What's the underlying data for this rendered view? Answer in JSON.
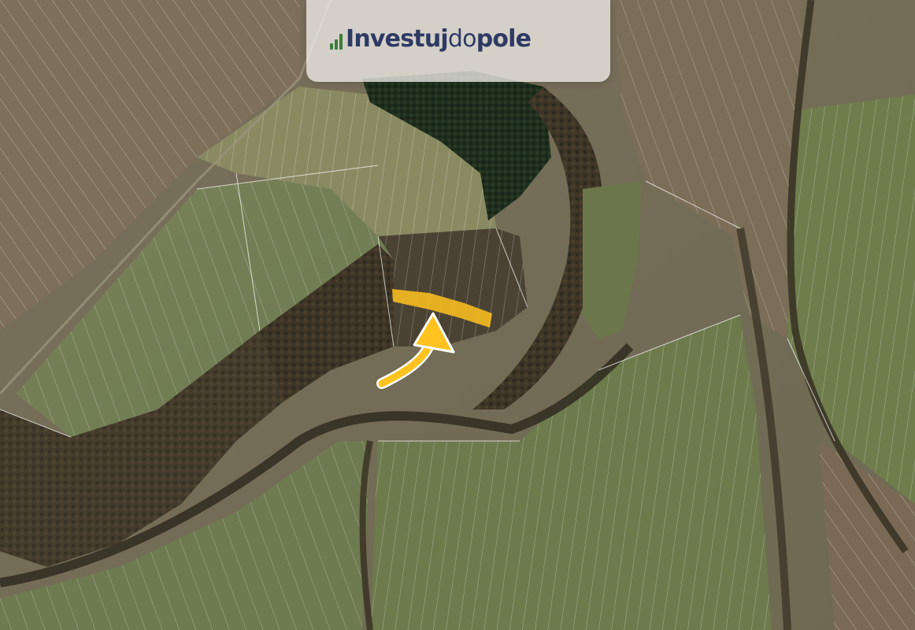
{
  "map": {
    "type": "aerial-cadastral",
    "highlight_color": "#ffc21f",
    "arrow_color": "#ffc21f",
    "parcel_line_color": "#ffffff"
  },
  "logo": {
    "part1": "Investuj",
    "part2": "do",
    "part3": "pole",
    "text_color": "#2e3a63",
    "mark_color": "#3c7d3a"
  }
}
